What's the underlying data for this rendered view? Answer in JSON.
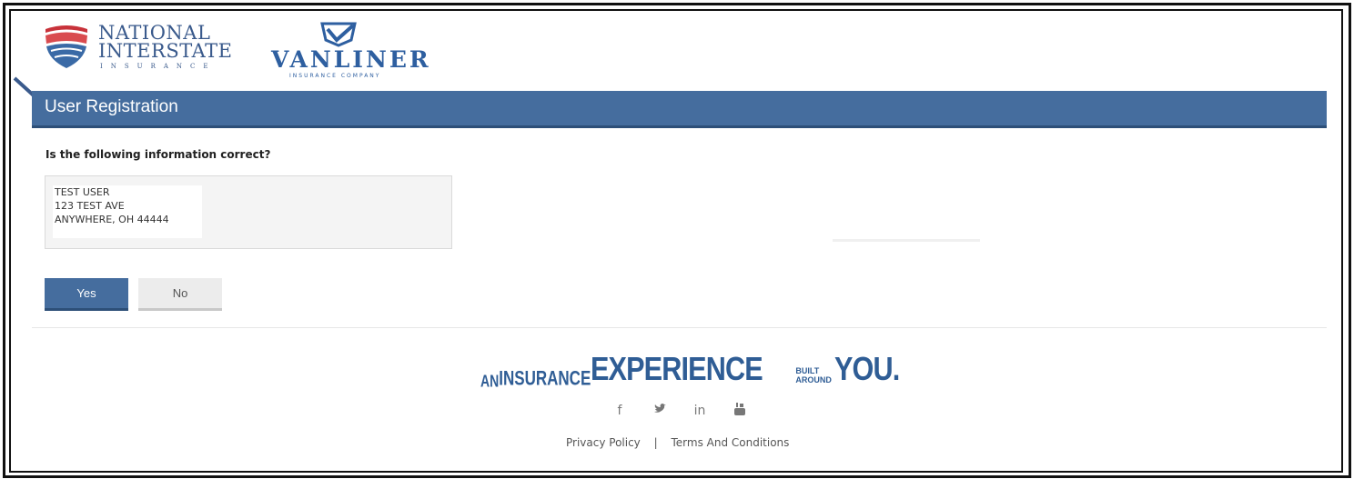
{
  "header": {
    "ni_logo": {
      "line1": "NATIONAL",
      "line2": "INTERSTATE",
      "line3": "INSURANCE"
    },
    "vanliner_logo": {
      "name": "VANLINER",
      "sub": "INSURANCE COMPANY"
    }
  },
  "page_title": "User Registration",
  "question": "Is the following information correct?",
  "address": [
    "TEST USER",
    "123 TEST AVE",
    "ANYWHERE, OH 44444"
  ],
  "buttons": {
    "yes": "Yes",
    "no": "No"
  },
  "tagline": {
    "an": "AN",
    "insurance": "INSURANCE",
    "experience": "EXPERIENCE",
    "built": "BUILT",
    "around": "AROUND",
    "you": "YOU."
  },
  "social": [
    "facebook-icon",
    "twitter-icon",
    "linkedin-icon",
    "youtube-icon"
  ],
  "footer": {
    "privacy": "Privacy Policy",
    "separator": "|",
    "terms": "Terms And Conditions"
  },
  "colors": {
    "brand_blue": "#456d9e",
    "brand_dark": "#2d4f78",
    "logo_blue": "#2e5fa0"
  }
}
